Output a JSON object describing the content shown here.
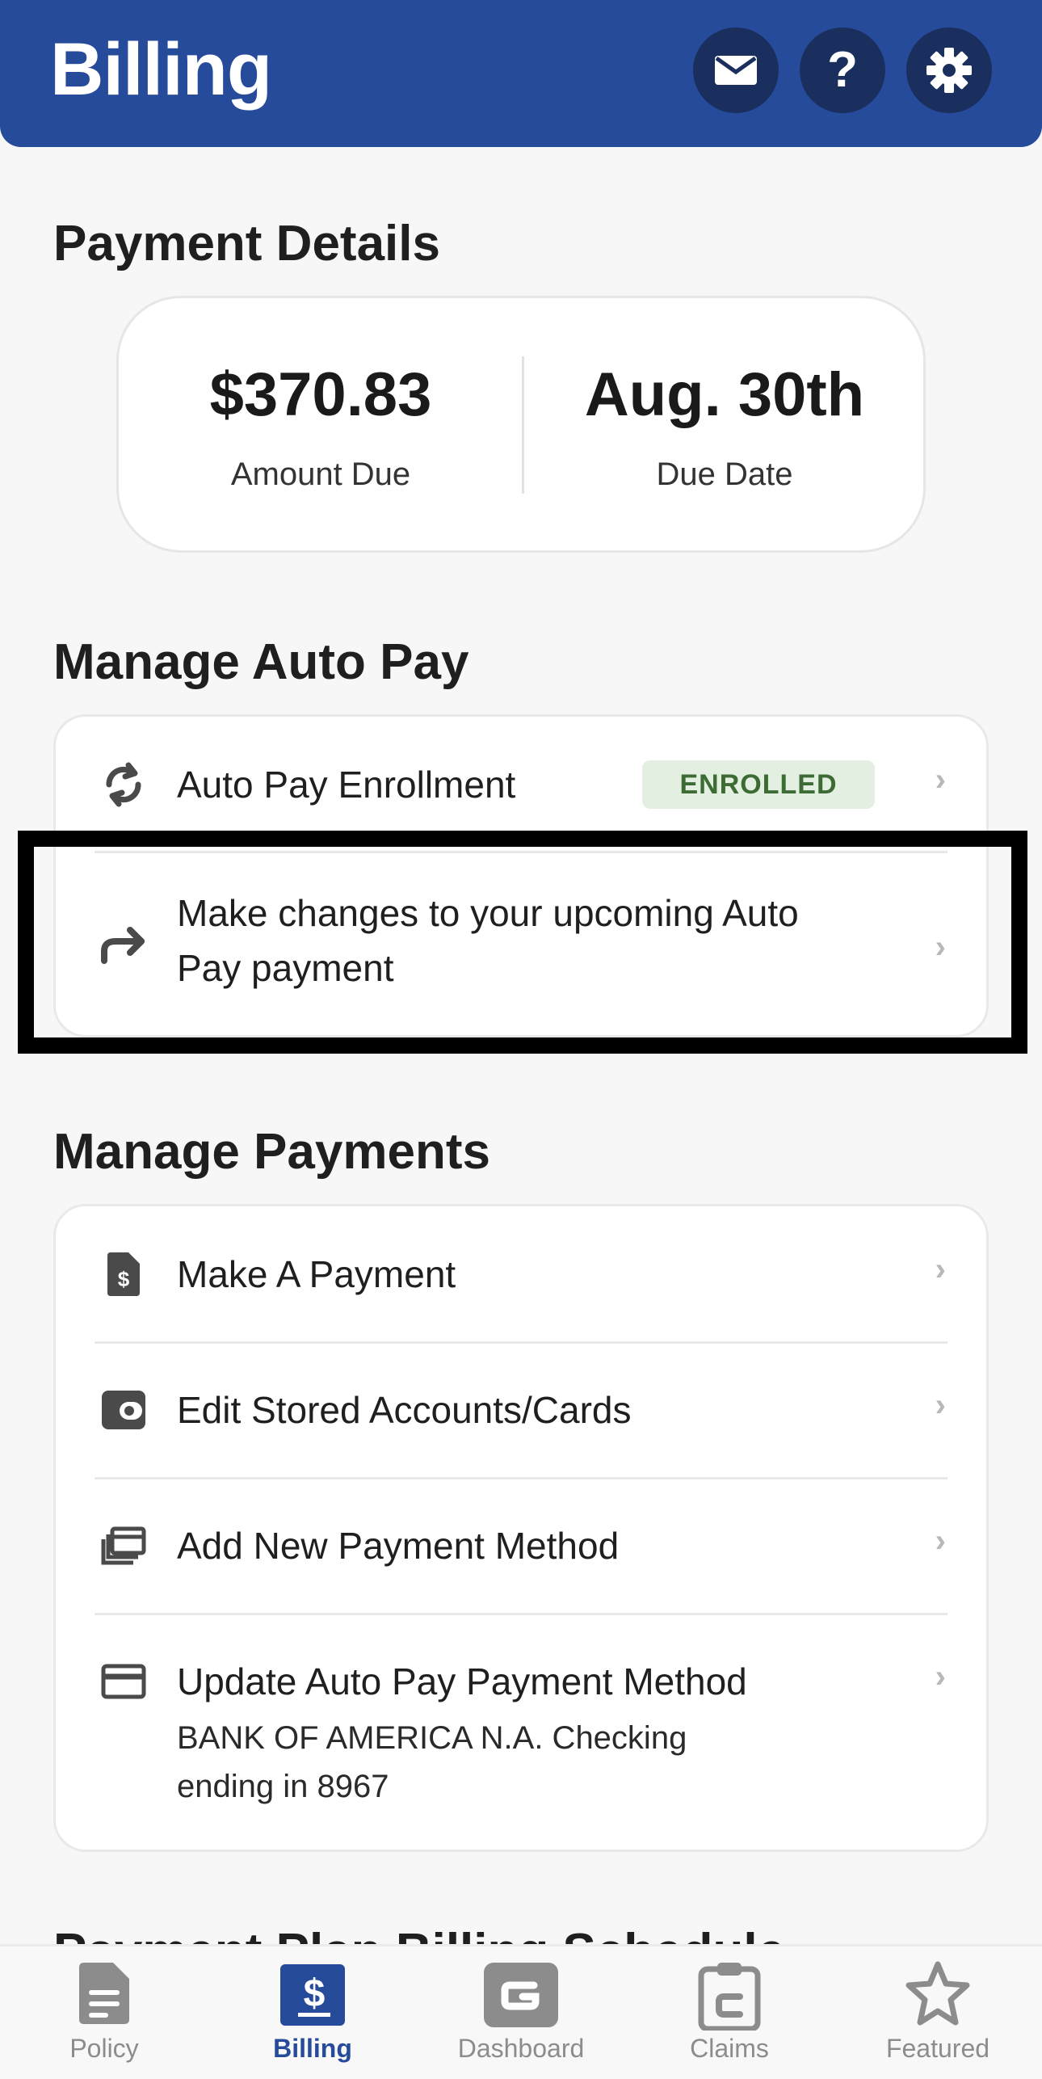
{
  "header": {
    "title": "Billing",
    "icons": [
      "mail-icon",
      "help-icon",
      "settings-icon"
    ],
    "help_glyph": "?"
  },
  "payment_details": {
    "title": "Payment Details",
    "amount": "$370.83",
    "amount_label": "Amount Due",
    "due_date": "Aug. 30th",
    "due_label": "Due Date"
  },
  "auto_pay": {
    "title": "Manage Auto Pay",
    "items": [
      {
        "label": "Auto Pay Enrollment",
        "icon": "refresh-icon",
        "badge": "ENROLLED"
      },
      {
        "label_line1": "Make changes to your upcoming Auto",
        "label_line2": "Pay payment",
        "icon": "forward-arrow-icon"
      }
    ]
  },
  "payments": {
    "title": "Manage Payments",
    "items": [
      {
        "label": "Make A Payment",
        "icon": "dollar-document-icon"
      },
      {
        "label": "Edit Stored Accounts/Cards",
        "icon": "wallet-icon"
      },
      {
        "label": "Add New Payment Method",
        "icon": "add-card-stack-icon"
      },
      {
        "label": "Update Auto Pay Payment Method",
        "sub1": "BANK OF AMERICA N.A. Checking",
        "sub2": "ending in 8967",
        "icon": "credit-card-icon"
      }
    ]
  },
  "peek_section": {
    "title": "Payment Plan Billing Schedule"
  },
  "bottom_nav": [
    {
      "label": "Policy",
      "icon": "policy-icon",
      "active": false
    },
    {
      "label": "Billing",
      "icon": "billing-icon",
      "active": true
    },
    {
      "label": "Dashboard",
      "icon": "dashboard-icon",
      "active": false
    },
    {
      "label": "Claims",
      "icon": "claims-icon",
      "active": false
    },
    {
      "label": "Featured",
      "icon": "featured-star-icon",
      "active": false
    }
  ],
  "colors": {
    "brand_blue": "#274b9b",
    "header_button": "#1a2f5e",
    "badge_bg": "#e3efe1",
    "badge_text": "#3c6b33"
  }
}
